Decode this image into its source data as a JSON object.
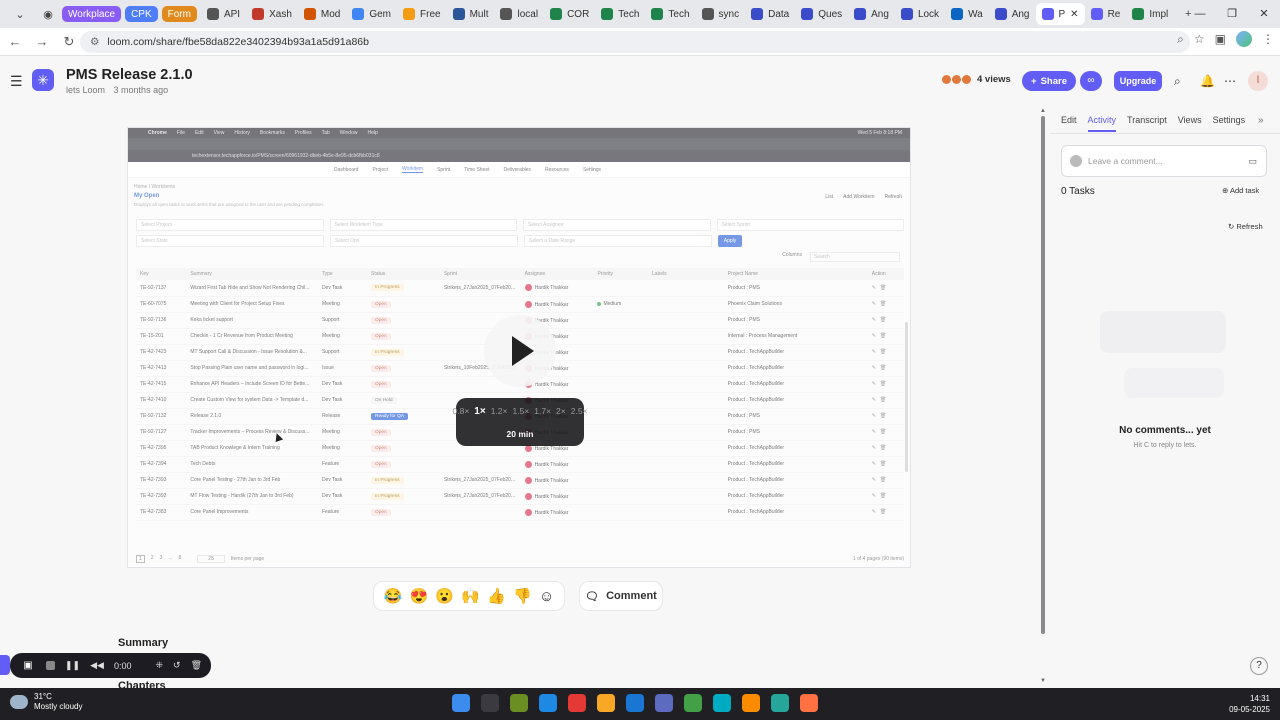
{
  "browser": {
    "tabs": [
      {
        "label": "Workplace",
        "color": "#8a5cf6",
        "chip": true
      },
      {
        "label": "CPK",
        "color": "#4f7cf7",
        "chip": true
      },
      {
        "label": "Form",
        "color": "#e08a1e",
        "chip": true
      },
      {
        "label": "API",
        "color": "#555555"
      },
      {
        "label": "Xash",
        "color": "#c0392b"
      },
      {
        "label": "Mod",
        "color": "#d35400"
      },
      {
        "label": "Gem",
        "color": "#4285f4"
      },
      {
        "label": "Free",
        "color": "#f39c12"
      },
      {
        "label": "Mult",
        "color": "#2b579a"
      },
      {
        "label": "local",
        "color": "#555555"
      },
      {
        "label": "COR",
        "color": "#1e8449"
      },
      {
        "label": "Tech",
        "color": "#1e8449"
      },
      {
        "label": "Tech",
        "color": "#1e8449"
      },
      {
        "label": "sync",
        "color": "#555555"
      },
      {
        "label": "Data",
        "color": "#3b4cca"
      },
      {
        "label": "Ques",
        "color": "#3b4cca"
      },
      {
        "label": "Ang",
        "color": "#3b4cca"
      },
      {
        "label": "Lock",
        "color": "#3b4cca"
      },
      {
        "label": "Wa",
        "color": "#0a66c2"
      },
      {
        "label": "Ang",
        "color": "#3b4cca"
      },
      {
        "label": "P",
        "color": "#625df5",
        "active": true
      },
      {
        "label": "Re",
        "color": "#625df5"
      },
      {
        "label": "Impl",
        "color": "#1e8449"
      }
    ],
    "url": "loom.com/share/fbe58da822e3402394b93a1a5d91a86b"
  },
  "loom": {
    "title": "PMS Release 2.1.0",
    "owner": "lets Loom",
    "age": "3 months ago",
    "views": "4 views",
    "share_label": "Share",
    "upgrade_label": "Upgrade",
    "avatar_letter": "l"
  },
  "video": {
    "os_bar": {
      "app": "Chrome",
      "menus": [
        "File",
        "Edit",
        "View",
        "History",
        "Bookmarks",
        "Profiles",
        "Tab",
        "Window",
        "Help"
      ],
      "clock": "Wed 5 Feb 8:18 PM"
    },
    "url": "techextensor.techappforce.io/PMS/screen/60961932-dbeb-4b5e-8e95-dcb6fbb031c8",
    "nav": [
      "Dashboard",
      "Project",
      "Workitem",
      "Sprint",
      "Time Sheet",
      "Deliverables",
      "Resources",
      "Settings"
    ],
    "nav_active": 2,
    "breadcrumb": "Home / Workitems",
    "view_title": "My Open",
    "view_desc": "Displays all open tasks or work items that are assigned to the user and are pending completion.",
    "actions": [
      "List",
      "Add Workitem",
      "Refresh"
    ],
    "filters_row1": [
      "Select Project",
      "Select Workitem Type",
      "Select Assignee",
      "Select Sprint"
    ],
    "filters_row2": [
      "Select Stats",
      "Select Ops",
      "Select a Date Range"
    ],
    "apply_label": "Apply",
    "columns_label": "Columns",
    "search_placeholder": "Search",
    "headers": [
      "Key",
      "Summary",
      "Type",
      "Status",
      "Sprint",
      "Assignee",
      "Priority",
      "Labels",
      "Project Name",
      "Action"
    ],
    "rows": [
      {
        "key": "TE-92-7137",
        "summary": "Wizard First Tab Hide and Show Not Rendering Chil...",
        "type": "Dev Task",
        "status": "In Progress",
        "sprint": "Strikers_27Jan2025_07Feb20...",
        "assignee": "Hardik Thakkar",
        "priority": "",
        "project": "Product : PMS"
      },
      {
        "key": "TE-60-7075",
        "summary": "Meeting with Client for Project Setup Fixes",
        "type": "Meeting",
        "status": "Open",
        "sprint": "",
        "assignee": "Hardik Thakkar",
        "priority": "Medium",
        "project": "Phoenix Claim Solutions"
      },
      {
        "key": "TE-92-7136",
        "summary": "Keka ticket support",
        "type": "Support",
        "status": "Open",
        "sprint": "",
        "assignee": "Hardik Thakkar",
        "priority": "",
        "project": "Product : PMS"
      },
      {
        "key": "TE-15-201",
        "summary": "Checkin - 1 Cr Revenue from Product Meeting",
        "type": "Meeting",
        "status": "Open",
        "sprint": "",
        "assignee": "Hardik Thakkar",
        "priority": "",
        "project": "Internal : Process Management"
      },
      {
        "key": "TE-42-7423",
        "summary": "MT Support Call & Discussion - Issue Resolution &...",
        "type": "Support",
        "status": "In Progress",
        "sprint": "",
        "assignee": "Hardik Thakkar",
        "priority": "",
        "project": "Product : TechAppBuilder"
      },
      {
        "key": "TE-42-7413",
        "summary": "Stop Passing Plain user name and password in logi...",
        "type": "Issue",
        "status": "Open",
        "sprint": "Strikers_10Feb2025_21Feb20...",
        "assignee": "Hardik Thakkar",
        "priority": "",
        "project": "Product : TechAppBuilder"
      },
      {
        "key": "TE-42-7415",
        "summary": "Enhance API Headers – Include Screen ID for Bette...",
        "type": "Dev Task",
        "status": "Open",
        "sprint": "",
        "assignee": "Hardik Thakkar",
        "priority": "",
        "project": "Product : TechAppBuilder"
      },
      {
        "key": "TE-42-7410",
        "summary": "Create Custom View for system Data -> Template d...",
        "type": "Dev Task",
        "status": "On Hold",
        "sprint": "",
        "assignee": "Hardik Thakkar",
        "priority": "",
        "project": "Product : TechAppBuilder"
      },
      {
        "key": "TE-92-7132",
        "summary": "Release 2.1.0",
        "type": "Release",
        "status": "Ready for QA",
        "sprint": "",
        "assignee": "Hardik Thakkar",
        "priority": "",
        "project": "Product : PMS"
      },
      {
        "key": "TE-92-7127",
        "summary": "Tracker Improvements – Process Review & Discuss...",
        "type": "Meeting",
        "status": "Open",
        "sprint": "",
        "assignee": "Hardik Thakkar",
        "priority": "",
        "project": "Product : PMS"
      },
      {
        "key": "TE-42-7395",
        "summary": "TAB Product Knowlege & Intern Training",
        "type": "Meeting",
        "status": "Open",
        "sprint": "",
        "assignee": "Hardik Thakkar",
        "priority": "",
        "project": "Product : TechAppBuilder"
      },
      {
        "key": "TE-42-7394",
        "summary": "Tech Debts",
        "type": "Feature",
        "status": "Open",
        "sprint": "",
        "assignee": "Hardik Thakkar",
        "priority": "",
        "project": "Product : TechAppBuilder"
      },
      {
        "key": "TE-42-7393",
        "summary": "Core Panel Testing - 27th Jan to 3rd Feb",
        "type": "Dev Task",
        "status": "In Progress",
        "sprint": "Strikers_27Jan2025_07Feb20...",
        "assignee": "Hardik Thakkar",
        "priority": "",
        "project": "Product : TechAppBuilder"
      },
      {
        "key": "TE-42-7392",
        "summary": "MT Flow Testing - Hardik (27th Jan to 3rd Feb)",
        "type": "Dev Task",
        "status": "In Progress",
        "sprint": "Strikers_27Jan2025_07Feb20...",
        "assignee": "Hardik Thakkar",
        "priority": "",
        "project": "Product : TechAppBuilder"
      },
      {
        "key": "TE-42-7383",
        "summary": "Core Panel Improvements",
        "type": "Feature",
        "status": "Open",
        "sprint": "",
        "assignee": "Hardik Thakkar",
        "priority": "",
        "project": "Product : TechAppBuilder"
      }
    ],
    "pager_pages": [
      "1",
      "2",
      "3",
      "...",
      "8"
    ],
    "page_size": "25",
    "items_per_page": "Items per page",
    "page_count": "1 of 4 pages (90 items)",
    "speeds": [
      "0.8×",
      "1×",
      "1.2×",
      "1.5×",
      "1.7×",
      "2×",
      "2.5×"
    ],
    "speed_current": "1×",
    "duration": "20 min"
  },
  "reactions": [
    "😂",
    "😍",
    "😮",
    "🙌",
    "👍",
    "👎",
    "☺"
  ],
  "comment_label": "Comment",
  "summary_heading": "Summary",
  "chapters_heading": "Chapters",
  "recorder": {
    "time": "0:00"
  },
  "panel": {
    "tabs": [
      "Edit",
      "Activity",
      "Transcript",
      "Views",
      "Settings"
    ],
    "active_tab": 1,
    "comment_placeholder": "Leave a comment...",
    "tasks_label": "0 Tasks",
    "add_task_label": "Add task",
    "refresh_label": "Refresh",
    "empty_title": "No comments... yet",
    "empty_hint": "Hit  C  to reply to lets."
  },
  "taskbar": {
    "temp": "31°C",
    "weather": "Mostly cloudy",
    "time": "14:31",
    "date": "09-05-2025"
  }
}
